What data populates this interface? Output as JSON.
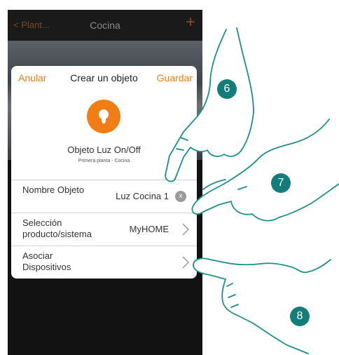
{
  "topbar": {
    "back_label": "< Plant...",
    "title": "Cocina",
    "add_icon": "plus-icon"
  },
  "dialog": {
    "cancel_label": "Anular",
    "title": "Crear un objeto",
    "save_label": "Guardar",
    "object_icon": "lightbulb-icon",
    "object_name": "Objeto Luz On/Off",
    "object_location": "Primera planta - Cocina",
    "rows": [
      {
        "label": "Nombre Objeto",
        "value": "Luz Cocina 1",
        "action_icon": "clear-icon",
        "action_text": "x"
      },
      {
        "label": "Selección producto/sistema",
        "value": "MyHOME",
        "action_icon": "chevron-right-icon"
      },
      {
        "label": "Asociar Dispositivos",
        "value": "",
        "action_icon": "chevron-right-icon"
      }
    ]
  },
  "steps": [
    "6",
    "7",
    "8"
  ],
  "colors": {
    "accent": "#f07d16",
    "badge": "#147d7a",
    "hand_outline": "#1c8f8a"
  }
}
